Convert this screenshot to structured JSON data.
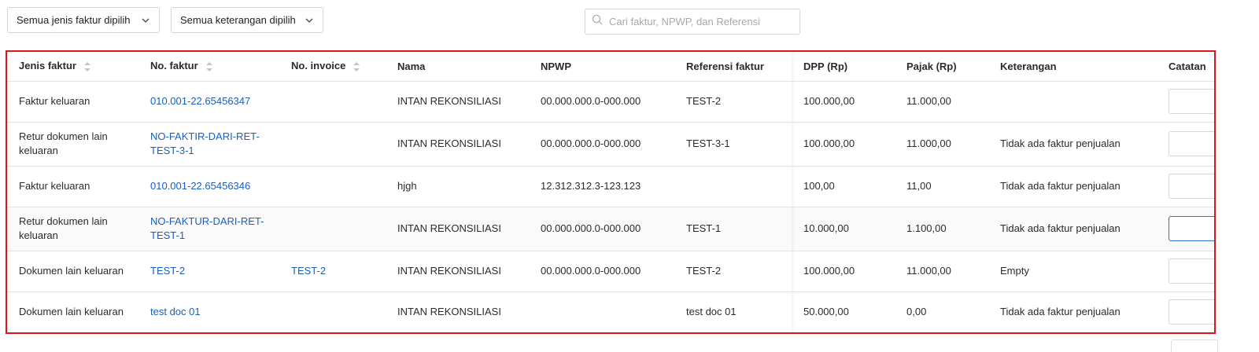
{
  "filters": {
    "invoice_type_label": "Semua jenis faktur dipilih",
    "description_label": "Semua keterangan dipilih",
    "search_placeholder": "Cari faktur, NPWP, dan Referensi"
  },
  "table": {
    "headers": {
      "jenis": "Jenis faktur",
      "no_faktur": "No. faktur",
      "no_invoice": "No. invoice",
      "nama": "Nama",
      "npwp": "NPWP",
      "referensi": "Referensi faktur",
      "dpp": "DPP (Rp)",
      "pajak": "Pajak (Rp)",
      "keterangan": "Keterangan",
      "catatan": "Catatan"
    },
    "rows": [
      {
        "jenis": "Faktur keluaran",
        "no_faktur": "010.001-22.65456347",
        "no_invoice": "",
        "nama": "INTAN REKONSILIASI",
        "npwp": "00.000.000.0-000.000",
        "referensi": "TEST-2",
        "dpp": "100.000,00",
        "pajak": "11.000,00",
        "keterangan": ""
      },
      {
        "jenis": "Retur dokumen lain keluaran",
        "no_faktur": "NO-FAKTIR-DARI-RET-TEST-3-1",
        "no_invoice": "",
        "nama": "INTAN REKONSILIASI",
        "npwp": "00.000.000.0-000.000",
        "referensi": "TEST-3-1",
        "dpp": "100.000,00",
        "pajak": "11.000,00",
        "keterangan": "Tidak ada faktur penjualan"
      },
      {
        "jenis": "Faktur keluaran",
        "no_faktur": "010.001-22.65456346",
        "no_invoice": "",
        "nama": "hjgh",
        "npwp": "12.312.312.3-123.123",
        "referensi": "",
        "dpp": "100,00",
        "pajak": "11,00",
        "keterangan": "Tidak ada faktur penjualan"
      },
      {
        "jenis": "Retur dokumen lain keluaran",
        "no_faktur": "NO-FAKTUR-DARI-RET-TEST-1",
        "no_invoice": "",
        "nama": "INTAN REKONSILIASI",
        "npwp": "00.000.000.0-000.000",
        "referensi": "TEST-1",
        "dpp": "10.000,00",
        "pajak": "1.100,00",
        "keterangan": "Tidak ada faktur penjualan"
      },
      {
        "jenis": "Dokumen lain keluaran",
        "no_faktur": "TEST-2",
        "no_invoice": "TEST-2",
        "nama": "INTAN REKONSILIASI",
        "npwp": "00.000.000.0-000.000",
        "referensi": "TEST-2",
        "dpp": "100.000,00",
        "pajak": "11.000,00",
        "keterangan": "Empty"
      },
      {
        "jenis": "Dokumen lain keluaran",
        "no_faktur": "test doc 01",
        "no_invoice": "",
        "nama": "INTAN REKONSILIASI",
        "npwp": "",
        "referensi": "test doc 01",
        "dpp": "50.000,00",
        "pajak": "0,00",
        "keterangan": "Tidak ada faktur penjualan"
      }
    ]
  },
  "colors": {
    "highlight_border": "#e0141e",
    "link": "#1a5fbf",
    "focus": "#2a6fd1"
  }
}
